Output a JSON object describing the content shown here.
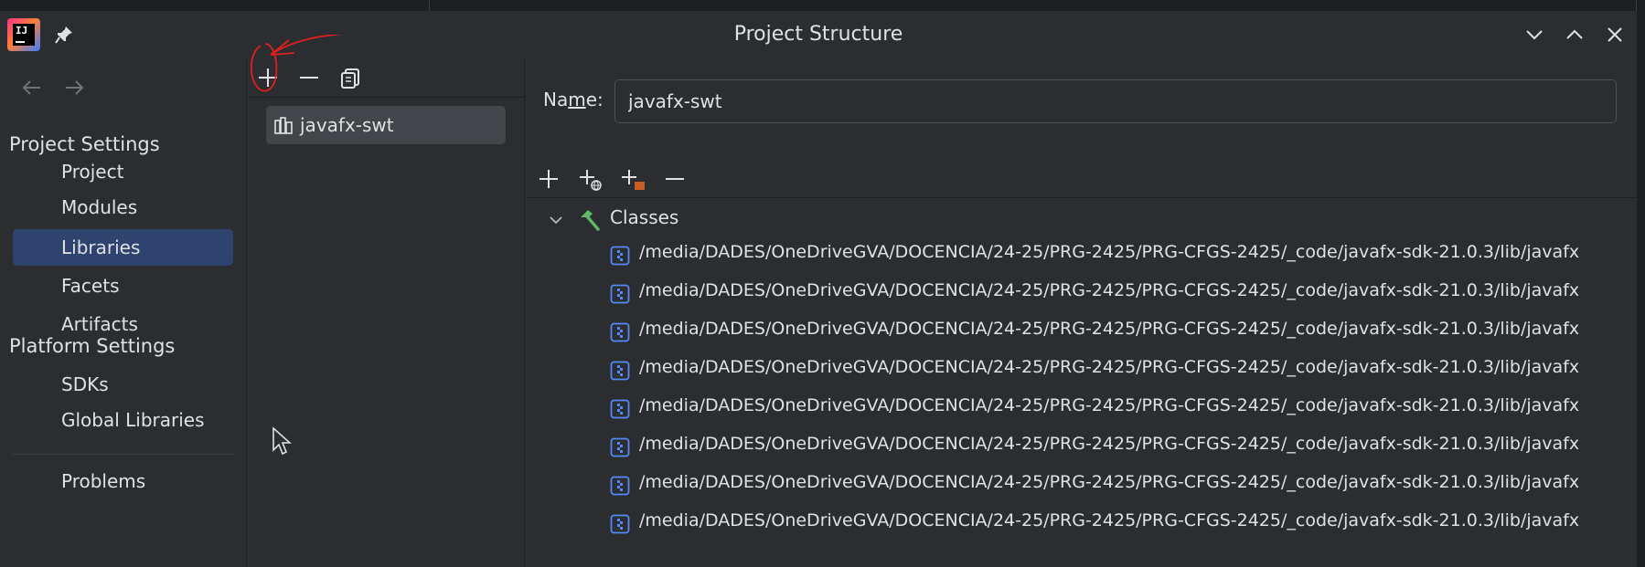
{
  "window": {
    "title": "Project Structure",
    "app_logo_text": "IJ"
  },
  "nav": {
    "project_settings_title": "Project Settings",
    "project_items": [
      {
        "label": "Project"
      },
      {
        "label": "Modules"
      },
      {
        "label": "Libraries",
        "selected": true
      },
      {
        "label": "Facets"
      },
      {
        "label": "Artifacts"
      }
    ],
    "platform_settings_title": "Platform Settings",
    "platform_items": [
      {
        "label": "SDKs"
      },
      {
        "label": "Global Libraries"
      }
    ],
    "problems_label": "Problems"
  },
  "libraries": {
    "items": [
      {
        "label": "javafx-swt",
        "selected": true
      }
    ]
  },
  "detail": {
    "name_label_pre": "Na",
    "name_label_underlined": "m",
    "name_label_post": "e:",
    "name_value": "javafx-swt",
    "tree_root_label": "Classes",
    "class_paths": [
      "/media/DADES/OneDriveGVA/DOCENCIA/24-25/PRG-2425/PRG-CFGS-2425/_code/javafx-sdk-21.0.3/lib/javafx",
      "/media/DADES/OneDriveGVA/DOCENCIA/24-25/PRG-2425/PRG-CFGS-2425/_code/javafx-sdk-21.0.3/lib/javafx",
      "/media/DADES/OneDriveGVA/DOCENCIA/24-25/PRG-2425/PRG-CFGS-2425/_code/javafx-sdk-21.0.3/lib/javafx",
      "/media/DADES/OneDriveGVA/DOCENCIA/24-25/PRG-2425/PRG-CFGS-2425/_code/javafx-sdk-21.0.3/lib/javafx",
      "/media/DADES/OneDriveGVA/DOCENCIA/24-25/PRG-2425/PRG-CFGS-2425/_code/javafx-sdk-21.0.3/lib/javafx",
      "/media/DADES/OneDriveGVA/DOCENCIA/24-25/PRG-2425/PRG-CFGS-2425/_code/javafx-sdk-21.0.3/lib/javafx",
      "/media/DADES/OneDriveGVA/DOCENCIA/24-25/PRG-2425/PRG-CFGS-2425/_code/javafx-sdk-21.0.3/lib/javafx",
      "/media/DADES/OneDriveGVA/DOCENCIA/24-25/PRG-2425/PRG-CFGS-2425/_code/javafx-sdk-21.0.3/lib/javafx"
    ]
  },
  "icons": {
    "pin": "pin-icon",
    "minimize": "chevron-down-icon",
    "maximize": "chevron-up-icon",
    "close": "close-icon",
    "back": "arrow-left-icon",
    "forward": "arrow-right-icon",
    "add": "plus-icon",
    "remove": "minus-icon",
    "copy": "copy-icon",
    "library": "library-icon",
    "classes": "hammer-icon",
    "jar": "jar-icon"
  },
  "colors": {
    "background": "#2b2d30",
    "selection": "#2e436e",
    "list_selection": "#43454a",
    "text": "#dfe1e5",
    "accent_blue": "#548af7",
    "hammer_green": "#5fb865",
    "annotation_red": "#e0201c"
  }
}
